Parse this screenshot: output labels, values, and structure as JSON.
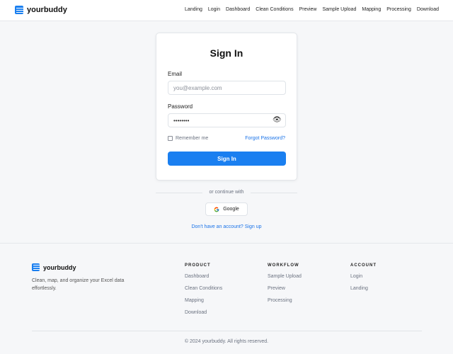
{
  "header": {
    "brand": "yourbuddy",
    "nav": [
      "Landing",
      "Login",
      "Dashboard",
      "Clean Conditions",
      "Preview",
      "Sample Upload",
      "Mapping",
      "Processing",
      "Download"
    ]
  },
  "signin": {
    "title": "Sign In",
    "email_label": "Email",
    "email_placeholder": "you@example.com",
    "password_label": "Password",
    "password_value": "••••••••",
    "remember_label": "Remember me",
    "forgot_label": "Forgot Password?",
    "button_label": "Sign In"
  },
  "alt": {
    "divider_text": "or continue with",
    "google_label": "Google",
    "signup_text": "Don't have an account? Sign up"
  },
  "footer": {
    "brand": "yourbuddy",
    "description": "Clean, map, and organize your Excel data effortlessly.",
    "columns": [
      {
        "title": "PRODUCT",
        "links": [
          "Dashboard",
          "Clean Conditions",
          "Mapping",
          "Download"
        ]
      },
      {
        "title": "WORKFLOW",
        "links": [
          "Sample Upload",
          "Preview",
          "Processing"
        ]
      },
      {
        "title": "ACCOUNT",
        "links": [
          "Login",
          "Landing"
        ]
      }
    ],
    "copyright": "© 2024 yourbuddy. All rights reserved."
  },
  "colors": {
    "accent": "#1a7ff0",
    "link": "#1a73e8",
    "background": "#f6f7f9"
  }
}
